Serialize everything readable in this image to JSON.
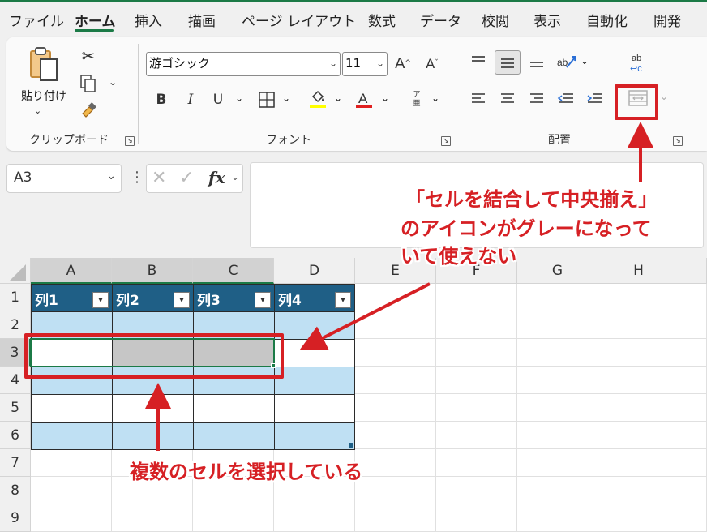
{
  "tabs": [
    "ファイル",
    "ホーム",
    "挿入",
    "描画",
    "ページ レイアウト",
    "数式",
    "データ",
    "校閲",
    "表示",
    "自動化",
    "開発"
  ],
  "clipboard": {
    "paste_label": "貼り付け",
    "group_label": "クリップボード"
  },
  "font": {
    "name": "游ゴシック",
    "size": "11",
    "group_label": "フォント",
    "bold": "B",
    "italic": "I",
    "underline": "U",
    "phonetic_top": "ア",
    "phonetic_bottom": "亜"
  },
  "alignment": {
    "group_label": "配置"
  },
  "formula_bar": {
    "name_box": "A3",
    "fx": "fx"
  },
  "columns": [
    "A",
    "B",
    "C",
    "D",
    "E",
    "F",
    "G",
    "H"
  ],
  "rows": [
    "1",
    "2",
    "3",
    "4",
    "5",
    "6",
    "7",
    "8",
    "9"
  ],
  "table": {
    "headers": [
      "列1",
      "列2",
      "列3",
      "列4"
    ]
  },
  "annotations": {
    "merge_note_line1": "「セルを結合して中央揃え」",
    "merge_note_line2": "のアイコンがグレーになって",
    "merge_note_line3": "いて使えない",
    "select_note": "複数のセルを選択している"
  },
  "colors": {
    "accent": "#1b7a46",
    "table_header": "#1f5f86",
    "table_band": "#bfe0f3",
    "annotation": "#d62024",
    "selection_fill": "#c6c6c6"
  }
}
